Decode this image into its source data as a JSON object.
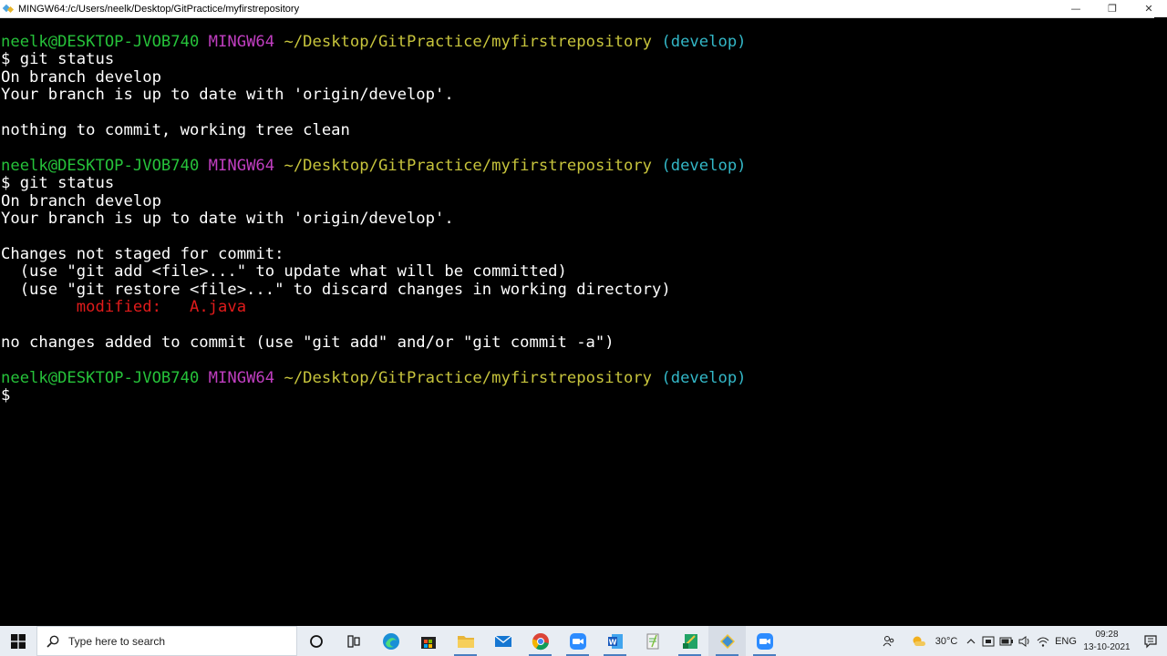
{
  "window": {
    "title": "MINGW64:/c/Users/neelk/Desktop/GitPractice/myfirstrepository",
    "minimize": "—",
    "maximize": "❐",
    "close": "✕"
  },
  "prompt": {
    "user": "neelk@DESKTOP-JVOB740",
    "system": "MINGW64",
    "path": "~/Desktop/GitPractice/myfirstrepository",
    "branch": "(develop)",
    "symbol": "$"
  },
  "terminal": {
    "cmd1": "git status",
    "out1_line1": "On branch develop",
    "out1_line2": "Your branch is up to date with 'origin/develop'.",
    "out1_line3": "nothing to commit, working tree clean",
    "cmd2": "git status",
    "out2_line1": "On branch develop",
    "out2_line2": "Your branch is up to date with 'origin/develop'.",
    "out2_line3": "Changes not staged for commit:",
    "out2_line4": "  (use \"git add <file>...\" to update what will be committed)",
    "out2_line5": "  (use \"git restore <file>...\" to discard changes in working directory)",
    "out2_modified_label": "        modified:   ",
    "out2_modified_file": "A.java",
    "out2_line7": "no changes added to commit (use \"git add\" and/or \"git commit -a\")"
  },
  "taskbar": {
    "search_placeholder": "Type here to search",
    "icons": [
      "cortana-icon",
      "task-view-icon",
      "edge-icon",
      "store-icon",
      "file-explorer-icon",
      "mail-icon",
      "chrome-icon",
      "zoom-icon",
      "word-icon",
      "notepad-icon",
      "excel-icon",
      "git-bash-icon",
      "zoom-meeting-icon"
    ],
    "weather_temp": "30°C",
    "language": "ENG",
    "time": "09:28",
    "date": "13-10-2021"
  },
  "colors": {
    "prompt_user": "#26c23a",
    "prompt_system": "#c03ec0",
    "prompt_path": "#c7c43c",
    "prompt_branch": "#33b7c7",
    "modified": "#e01b1b",
    "text": "#ffffff",
    "background": "#000000"
  }
}
